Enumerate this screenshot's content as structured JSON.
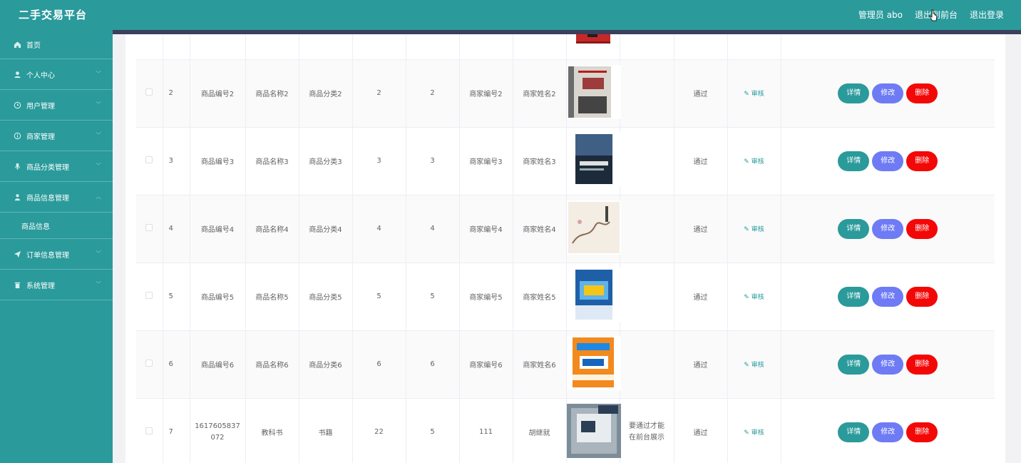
{
  "header": {
    "brand": "二手交易平台",
    "admin_label": "管理员 abo",
    "front_label": "退出到前台",
    "logout_label": "退出登录"
  },
  "sidebar": {
    "items": [
      {
        "label": "首页",
        "icon": "home-icon"
      },
      {
        "label": "个人中心",
        "icon": "user-icon"
      },
      {
        "label": "用户管理",
        "icon": "clock-icon"
      },
      {
        "label": "商家管理",
        "icon": "info-icon"
      },
      {
        "label": "商品分类管理",
        "icon": "mic-icon"
      },
      {
        "label": "商品信息管理",
        "icon": "person-icon"
      },
      {
        "label": "订单信息管理",
        "icon": "send-icon"
      },
      {
        "label": "系统管理",
        "icon": "trash-icon"
      }
    ],
    "submenu_label": "商品信息"
  },
  "table": {
    "rows": [
      {
        "idx": "2",
        "code": "商品编号2",
        "name": "商品名称2",
        "category": "商品分类2",
        "v1": "2",
        "v2": "2",
        "merchant_no": "商家编号2",
        "merchant_name": "商家姓名2",
        "note": "",
        "status": "通过"
      },
      {
        "idx": "3",
        "code": "商品编号3",
        "name": "商品名称3",
        "category": "商品分类3",
        "v1": "3",
        "v2": "3",
        "merchant_no": "商家编号3",
        "merchant_name": "商家姓名3",
        "note": "",
        "status": "通过"
      },
      {
        "idx": "4",
        "code": "商品编号4",
        "name": "商品名称4",
        "category": "商品分类4",
        "v1": "4",
        "v2": "4",
        "merchant_no": "商家编号4",
        "merchant_name": "商家姓名4",
        "note": "",
        "status": "通过"
      },
      {
        "idx": "5",
        "code": "商品编号5",
        "name": "商品名称5",
        "category": "商品分类5",
        "v1": "5",
        "v2": "5",
        "merchant_no": "商家编号5",
        "merchant_name": "商家姓名5",
        "note": "",
        "status": "通过"
      },
      {
        "idx": "6",
        "code": "商品编号6",
        "name": "商品名称6",
        "category": "商品分类6",
        "v1": "6",
        "v2": "6",
        "merchant_no": "商家编号6",
        "merchant_name": "商家姓名6",
        "note": "",
        "status": "通过"
      },
      {
        "idx": "7",
        "code": "1617605837072",
        "name": "教科书",
        "category": "书籍",
        "v1": "22",
        "v2": "5",
        "merchant_no": "111",
        "merchant_name": "胡继就",
        "note": "要通过才能在前台展示",
        "status": "通过"
      }
    ],
    "audit_label": "审核",
    "detail_label": "详情",
    "edit_label": "修改",
    "delete_label": "删除"
  },
  "colors": {
    "primary": "#2a9a9b",
    "edit": "#6e7bf5",
    "delete": "#f30808",
    "topbar_line": "#3b3f5c"
  }
}
